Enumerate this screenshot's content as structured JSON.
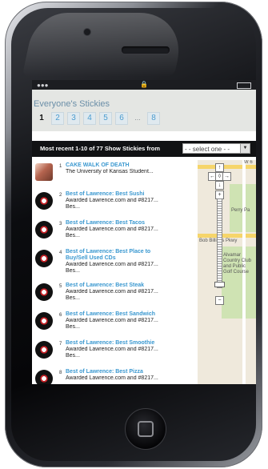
{
  "screen": {
    "page_title": "Everyone's Stickies",
    "pages": [
      "1",
      "2",
      "3",
      "4",
      "5",
      "6",
      "...",
      "8"
    ],
    "current_page": "1",
    "filter": {
      "text": "Most recent 1-10 of 77   Show Stickies from",
      "select_value": "- - select one - -"
    },
    "items": [
      {
        "number": "1",
        "title": "CAKE WALK OF DEATH",
        "desc": "The University of Kansas Student...",
        "more": "",
        "thumb": "photo"
      },
      {
        "number": "2",
        "title": "Best of Lawrence: Best Sushi",
        "desc": "Awarded Lawrence.com and #8217...",
        "more": "Bes...",
        "thumb": "logo"
      },
      {
        "number": "3",
        "title": "Best of Lawrence: Best Tacos",
        "desc": "Awarded Lawrence.com and #8217...",
        "more": "Bes...",
        "thumb": "logo"
      },
      {
        "number": "4",
        "title": "Best of Lawrence: Best Place to Buy/Sell Used CDs",
        "desc": "Awarded Lawrence.com and #8217...",
        "more": "Bes...",
        "thumb": "logo"
      },
      {
        "number": "5",
        "title": "Best of Lawrence: Best Steak",
        "desc": "Awarded Lawrence.com and #8217...",
        "more": "Bes...",
        "thumb": "logo"
      },
      {
        "number": "6",
        "title": "Best of Lawrence: Best Sandwich",
        "desc": "Awarded Lawrence.com and #8217...",
        "more": "Bes...",
        "thumb": "logo"
      },
      {
        "number": "7",
        "title": "Best of Lawrence: Best Smoothie",
        "desc": "Awarded Lawrence.com and #8217...",
        "more": "Bes...",
        "thumb": "logo"
      },
      {
        "number": "8",
        "title": "Best of Lawrence: Best Pizza",
        "desc": "Awarded Lawrence.com and #8217...",
        "more": "",
        "thumb": "logo"
      }
    ],
    "map": {
      "labels": [
        "W 6",
        "Perry Pa",
        "Bob Billings Pkwy",
        "Alvamar Country Club and Public Golf Course"
      ]
    }
  },
  "colors": {
    "link": "#3a98d0",
    "header_bg": "#e4e6e3",
    "filter_bg": "#111214"
  }
}
